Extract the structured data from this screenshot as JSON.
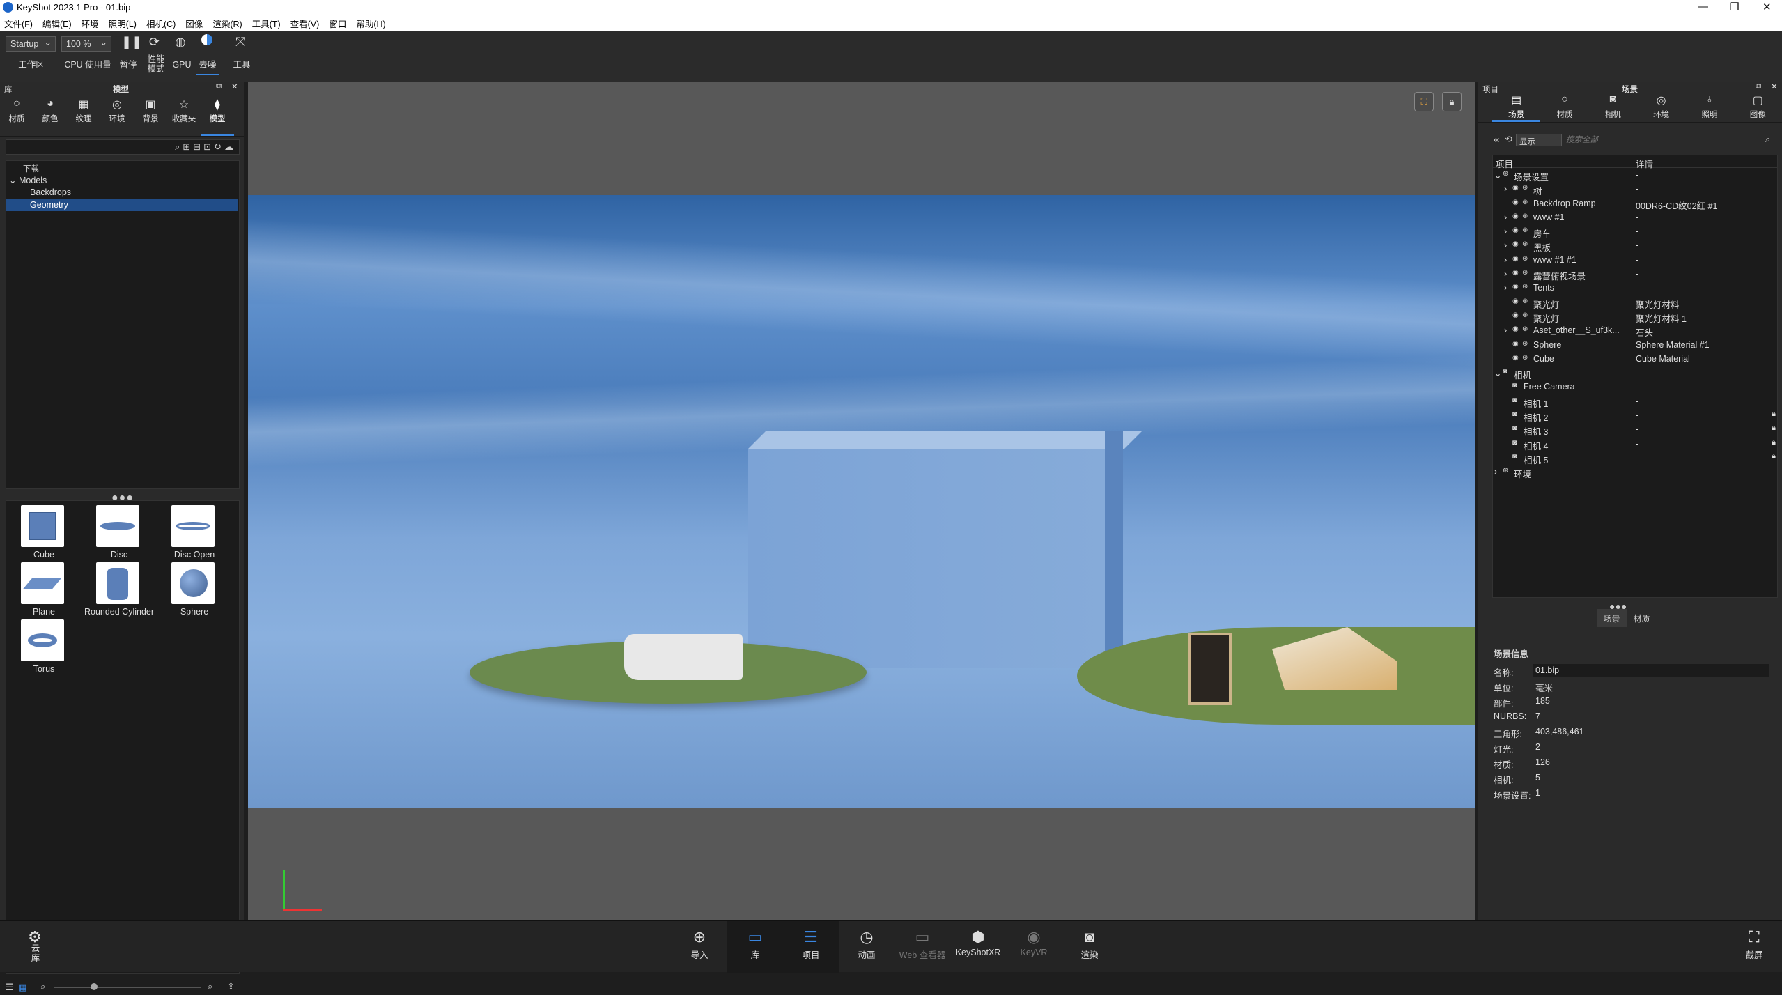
{
  "window": {
    "title": "KeyShot 2023.1 Pro  - 01.bip",
    "minimize": "—",
    "restore": "❐",
    "close": "✕"
  },
  "menu": [
    "文件(F)",
    "编辑(E)",
    "环境",
    "照明(L)",
    "相机(C)",
    "图像",
    "渲染(R)",
    "工具(T)",
    "查看(V)",
    "窗口",
    "帮助(H)"
  ],
  "toolbar": {
    "workspace_value": "Startup",
    "workspace_label": "工作区",
    "cpu_value": "100 %",
    "cpu_label": "CPU 使用量",
    "pause_label": "暂停",
    "perf_label": "性能\n模式",
    "gpu_label": "GPU",
    "denoise_label": "去噪",
    "tools_label": "工具"
  },
  "library": {
    "title": "库",
    "panel_title": "模型",
    "tabs": [
      "材质",
      "颜色",
      "纹理",
      "环境",
      "背景",
      "收藏夹",
      "模型"
    ],
    "tree_header": "下载",
    "tree": [
      "Models",
      "Backdrops",
      "Geometry"
    ],
    "items": [
      "Cube",
      "Disc",
      "Disc Open",
      "Plane",
      "Rounded Cylinder",
      "Sphere",
      "Torus"
    ]
  },
  "project": {
    "title": "项目",
    "panel_title": "场景",
    "tabs": [
      "场景",
      "材质",
      "相机",
      "环境",
      "照明",
      "图像"
    ],
    "display_select": "显示",
    "search_placeholder": "搜索全部",
    "col_item": "项目",
    "col_detail": "详情",
    "rows": [
      {
        "name": "场景设置",
        "detail": "-"
      },
      {
        "name": "树",
        "detail": "-"
      },
      {
        "name": "Backdrop Ramp",
        "detail": "00DR6-CD纹02红 #1"
      },
      {
        "name": "www #1",
        "detail": "-"
      },
      {
        "name": "房车",
        "detail": "-"
      },
      {
        "name": "黑板",
        "detail": "-"
      },
      {
        "name": "www #1 #1",
        "detail": "-"
      },
      {
        "name": "露营俯视场景",
        "detail": "-"
      },
      {
        "name": "Tents",
        "detail": "-"
      },
      {
        "name": "聚光灯",
        "detail": "聚光灯材料"
      },
      {
        "name": "聚光灯",
        "detail": "聚光灯材料 1"
      },
      {
        "name": "Aset_other__S_uf3k...",
        "detail": "石头"
      },
      {
        "name": "Sphere",
        "detail": "Sphere Material #1"
      },
      {
        "name": "Cube",
        "detail": "Cube Material"
      },
      {
        "name": "相机",
        "detail": ""
      },
      {
        "name": "Free Camera",
        "detail": "-"
      },
      {
        "name": "相机 1",
        "detail": "-"
      },
      {
        "name": "相机 2",
        "detail": "-"
      },
      {
        "name": "相机 3",
        "detail": "-"
      },
      {
        "name": "相机 4",
        "detail": "-"
      },
      {
        "name": "相机 5",
        "detail": "-"
      },
      {
        "name": "环境",
        "detail": ""
      }
    ],
    "subtabs": [
      "场景",
      "材质"
    ],
    "info_title": "场景信息",
    "info": [
      {
        "k": "名称:",
        "v": "01.bip"
      },
      {
        "k": "单位:",
        "v": "毫米"
      },
      {
        "k": "部件:",
        "v": "185"
      },
      {
        "k": "NURBS:",
        "v": "7"
      },
      {
        "k": "三角形:",
        "v": "403,486,461"
      },
      {
        "k": "灯光:",
        "v": "2"
      },
      {
        "k": "材质:",
        "v": "126"
      },
      {
        "k": "相机:",
        "v": "5"
      },
      {
        "k": "场景设置:",
        "v": "1"
      }
    ]
  },
  "bottom": {
    "cloud": "云\n库",
    "buttons": [
      "导入",
      "库",
      "项目",
      "动画",
      "Web 查看器",
      "KeyShotXR",
      "KeyVR",
      "渲染"
    ],
    "screenshot": "截屏"
  },
  "colors": {
    "accent": "#3a86e0",
    "selection": "#214d88",
    "panel": "#2a2a2a",
    "viewport": "#585858"
  }
}
